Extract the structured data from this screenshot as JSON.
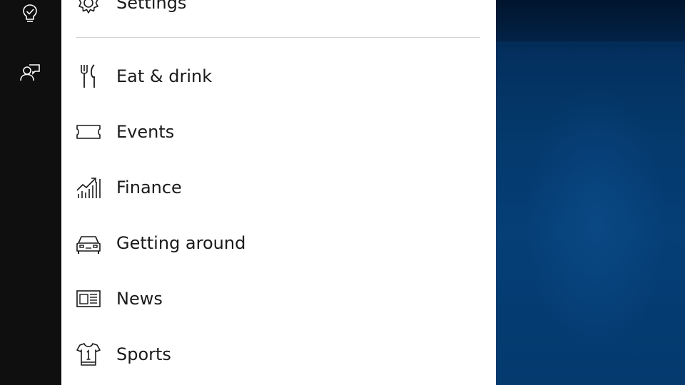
{
  "rail": {
    "items": [
      {
        "icon": "lightbulb-check-icon"
      },
      {
        "icon": "person-feedback-icon"
      }
    ]
  },
  "menu": {
    "settings": {
      "label": "Settings",
      "icon": "gear-icon"
    },
    "items": [
      {
        "label": "Eat & drink",
        "icon": "fork-knife-icon"
      },
      {
        "label": "Events",
        "icon": "ticket-icon"
      },
      {
        "label": "Finance",
        "icon": "finance-chart-icon"
      },
      {
        "label": "Getting around",
        "icon": "car-icon"
      },
      {
        "label": "News",
        "icon": "newspaper-icon"
      },
      {
        "label": "Sports",
        "icon": "jersey-icon"
      }
    ]
  },
  "colors": {
    "rail": "#0f0f10",
    "panel": "#ffffff",
    "text": "#1a1a1a",
    "desktop": "#04396c"
  }
}
